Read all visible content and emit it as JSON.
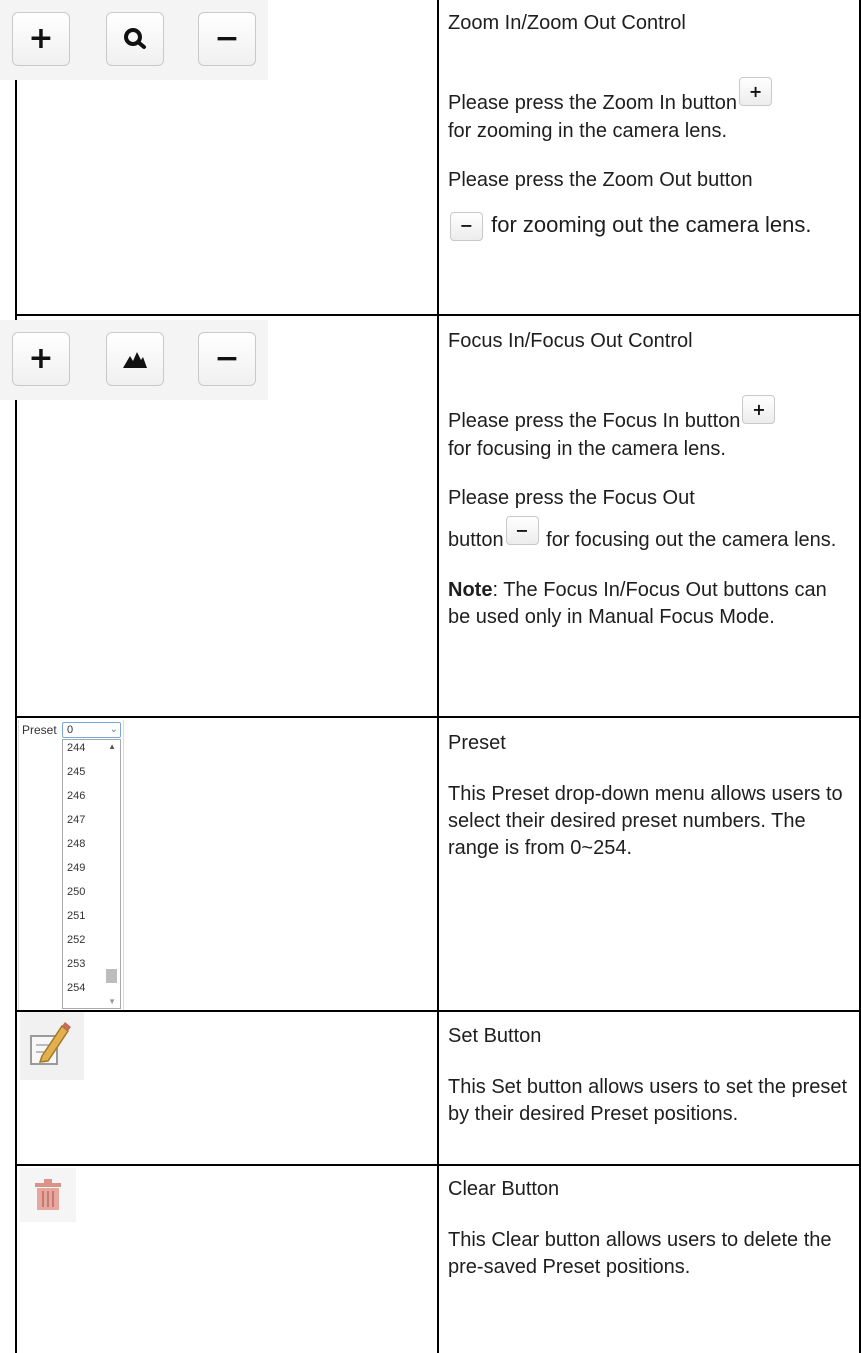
{
  "zoom": {
    "title": "Zoom In/Zoom Out Control",
    "in_text_a": "Please press the Zoom In button",
    "in_text_b": "for zooming in the camera lens.",
    "out_text_a": "Please press the Zoom Out button",
    "out_text_b": "for zooming out the camera lens.",
    "buttons": {
      "plus": "+",
      "minus": "−"
    }
  },
  "focus": {
    "title": "Focus In/Focus Out Control",
    "in_text_a": "Please press the Focus In button",
    "in_text_b": "for focusing in the camera lens.",
    "out_text_a": "Please press the Focus Out",
    "out_text_b": "button",
    "out_text_c": "for focusing out the camera lens.",
    "note_label": "Note",
    "note_text": ": The Focus In/Focus Out buttons can be used only in Manual Focus Mode.",
    "buttons": {
      "plus": "+",
      "minus": "−"
    }
  },
  "preset": {
    "title": "Preset",
    "description": "This Preset drop-down menu allows users to select their desired preset numbers. The range is from 0~254.",
    "label": "Preset",
    "selected": "0",
    "options": [
      "244",
      "245",
      "246",
      "247",
      "248",
      "249",
      "250",
      "251",
      "252",
      "253",
      "254"
    ]
  },
  "set": {
    "title": "Set Button",
    "description": "This Set button allows users to set the preset by their desired Preset positions."
  },
  "clear": {
    "title": "Clear Button",
    "description": "This Clear button allows users to delete the pre-saved Preset positions."
  },
  "icons": {
    "zoom": "magnifier-icon",
    "focus": "mountain-icon",
    "set": "pencil-icon",
    "clear": "trash-icon"
  },
  "colors": {
    "grid": "#000000",
    "text": "#1e1e1e",
    "select_border": "#7aa7d8",
    "trash": "#d9938a"
  }
}
